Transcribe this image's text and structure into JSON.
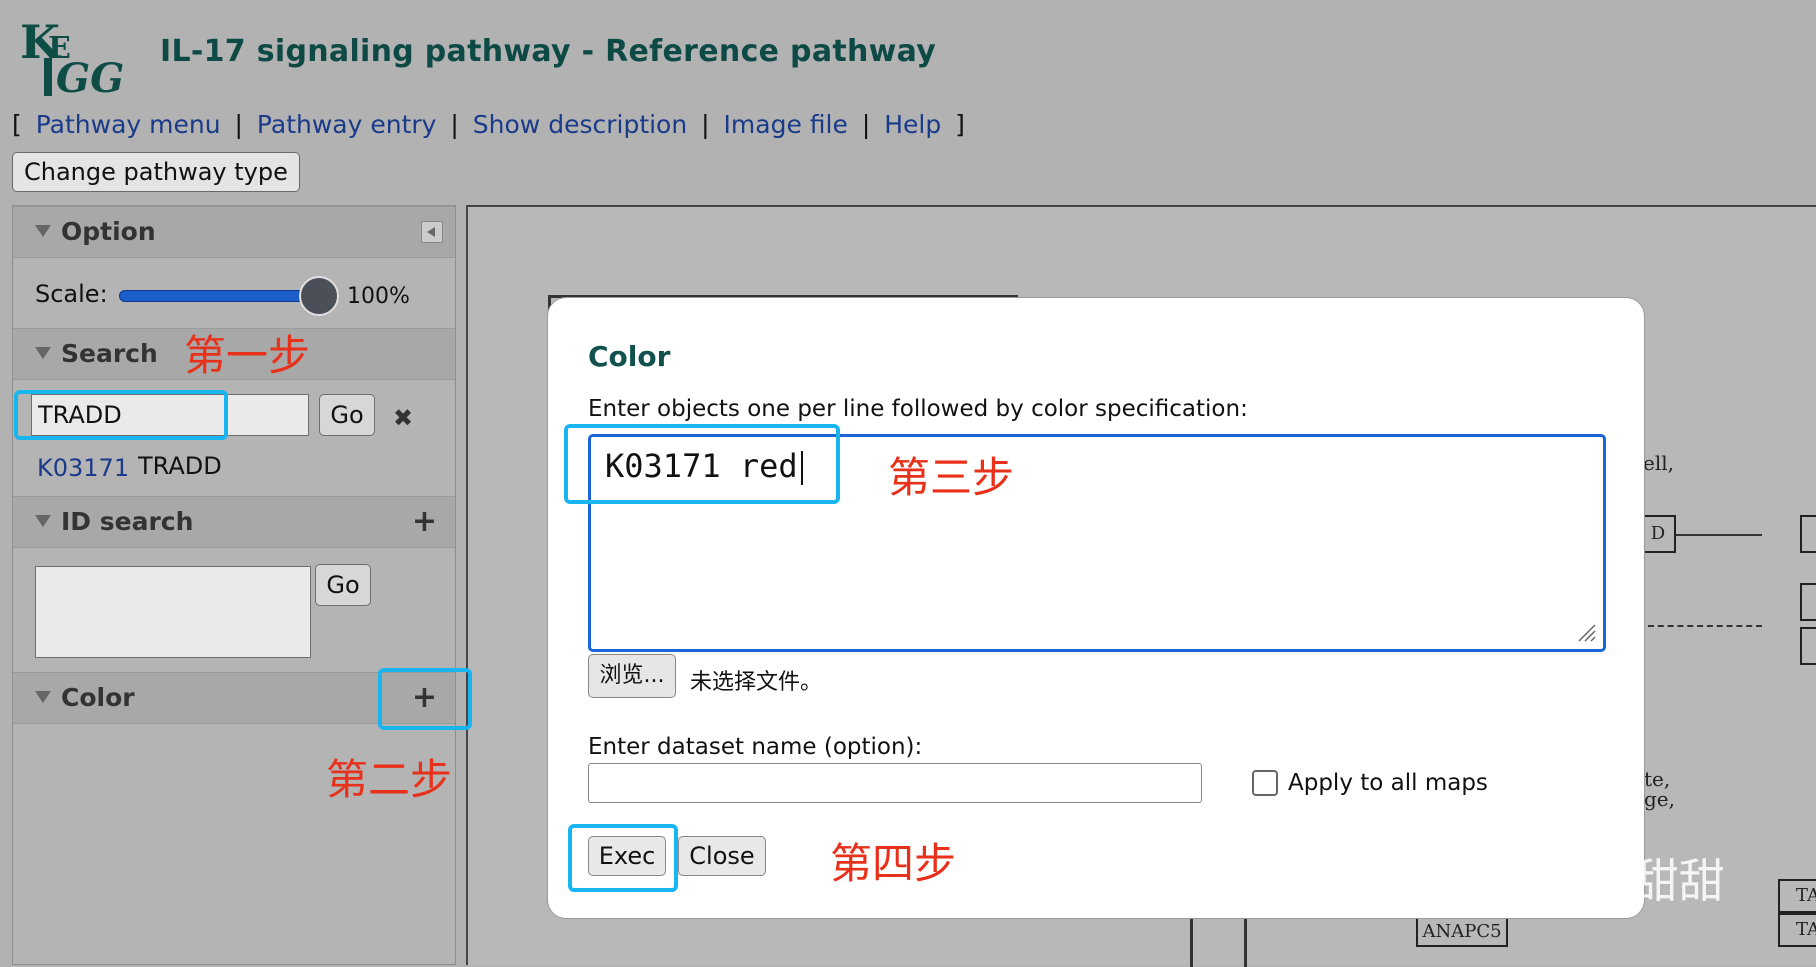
{
  "header": {
    "title": "IL-17 signaling pathway - Reference pathway",
    "menu": [
      "Pathway menu",
      "Pathway entry",
      "Show description",
      "Image file",
      "Help"
    ],
    "change_type": "Change pathway type"
  },
  "sidebar": {
    "option_label": "Option",
    "scale_label": "Scale:",
    "scale_value": "100%",
    "scale_level_percent": 100,
    "search_label": "Search",
    "search_value": "TRADD",
    "go_label": "Go",
    "result_id": "K03171",
    "result_name": "TRADD",
    "id_search_label": "ID search",
    "color_label": "Color"
  },
  "annotations": {
    "step1": "第一步",
    "step2": "第二步",
    "step3": "第三步",
    "step4": "第四步",
    "highlight_color": "#19b5f0",
    "text_color": "#e8311b"
  },
  "dialog": {
    "title": "Color",
    "prompt": "Enter objects one per line followed by color specification:",
    "textarea_value": "K03171 red",
    "browse_label": "浏览...",
    "no_file_label": "未选择文件。",
    "dataset_label": "Enter dataset name (option):",
    "dataset_value": "",
    "apply_all_label": "Apply to all maps",
    "exec_label": "Exec",
    "close_label": "Close"
  },
  "map": {
    "texts": [
      "ell,",
      "D",
      "te,",
      "ge,",
      "ANAPC5",
      "TA",
      "TA"
    ]
  },
  "watermark": "知乎 @甜甜"
}
